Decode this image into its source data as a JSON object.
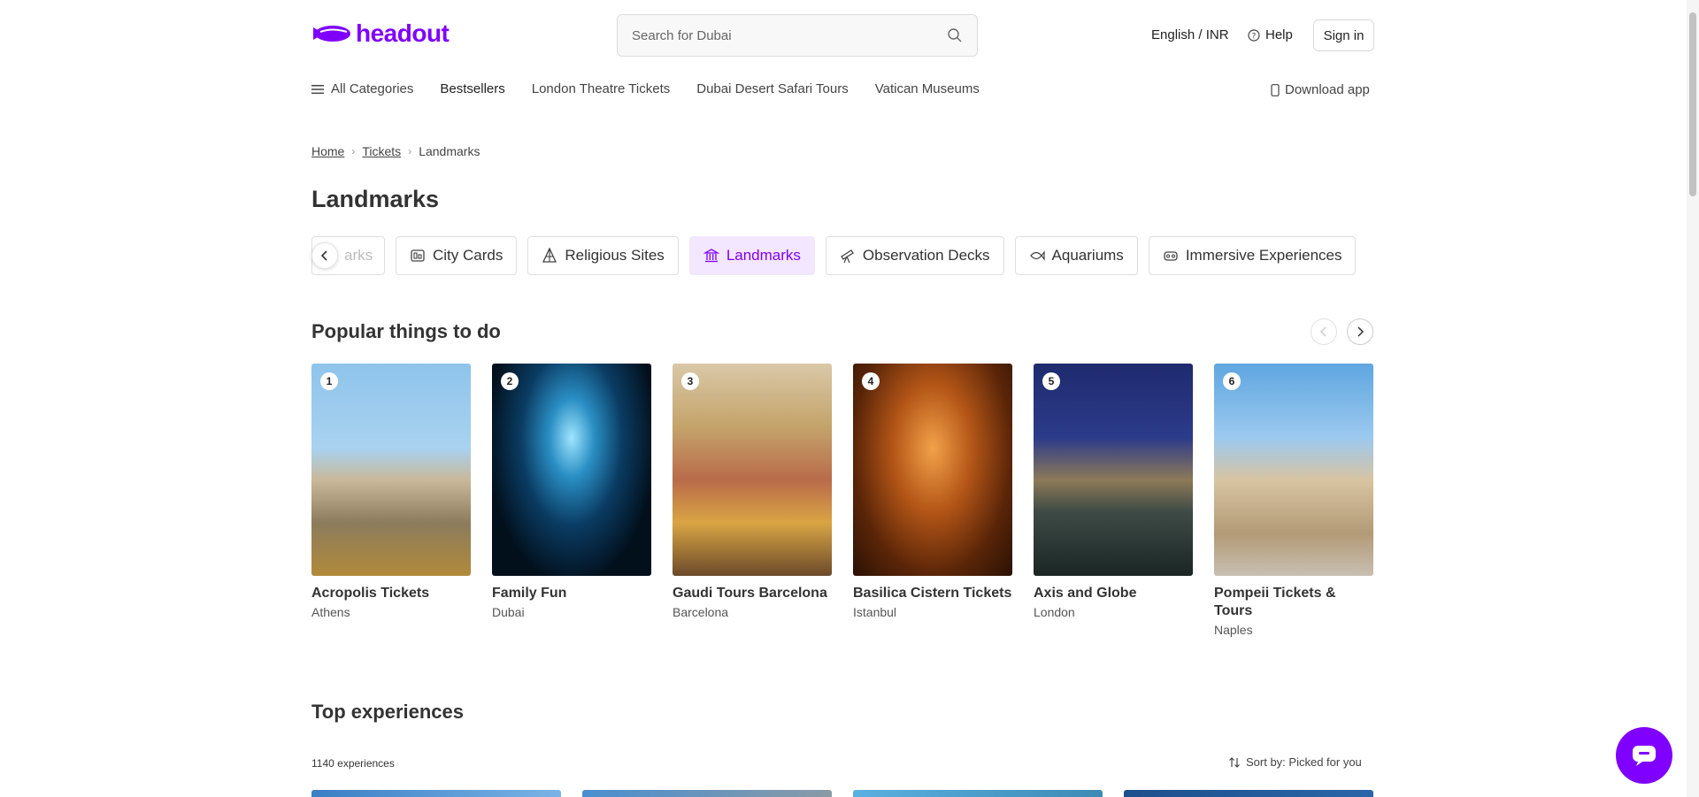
{
  "header": {
    "logo_text": "headout",
    "search_placeholder": "Search for Dubai",
    "language_currency": "English / INR",
    "help_label": "Help",
    "signin_label": "Sign in"
  },
  "nav": {
    "all_categories": "All Categories",
    "items": [
      "Bestsellers",
      "London Theatre Tickets",
      "Dubai Desert Safari Tours",
      "Vatican Museums"
    ],
    "download_app": "Download app"
  },
  "breadcrumb": [
    "Home",
    "Tickets",
    "Landmarks"
  ],
  "page_title": "Landmarks",
  "categories": [
    {
      "label": "arks",
      "icon": "theme-park-icon",
      "state": "faded"
    },
    {
      "label": "City Cards",
      "icon": "city-card-icon",
      "state": "normal"
    },
    {
      "label": "Religious Sites",
      "icon": "religious-site-icon",
      "state": "normal"
    },
    {
      "label": "Landmarks",
      "icon": "landmark-icon",
      "state": "active"
    },
    {
      "label": "Observation Decks",
      "icon": "telescope-icon",
      "state": "normal"
    },
    {
      "label": "Aquariums",
      "icon": "fish-icon",
      "state": "normal"
    },
    {
      "label": "Immersive Experiences",
      "icon": "vr-headset-icon",
      "state": "normal"
    }
  ],
  "popular": {
    "title": "Popular things to do",
    "cards": [
      {
        "rank": "1",
        "name": "Acropolis Tickets",
        "city": "Athens"
      },
      {
        "rank": "2",
        "name": "Family Fun",
        "city": "Dubai"
      },
      {
        "rank": "3",
        "name": "Gaudi Tours Barcelona",
        "city": "Barcelona"
      },
      {
        "rank": "4",
        "name": "Basilica Cistern Tickets",
        "city": "Istanbul"
      },
      {
        "rank": "5",
        "name": "Axis and Globe",
        "city": "London"
      },
      {
        "rank": "6",
        "name": "Pompeii Tickets & Tours",
        "city": "Naples"
      }
    ]
  },
  "top_experiences": {
    "title": "Top experiences",
    "count_label": "1140 experiences",
    "sort_label": "Sort by: Picked for you"
  },
  "colors": {
    "brand": "#8000ff",
    "active_chip_bg": "#f3e6ff"
  }
}
